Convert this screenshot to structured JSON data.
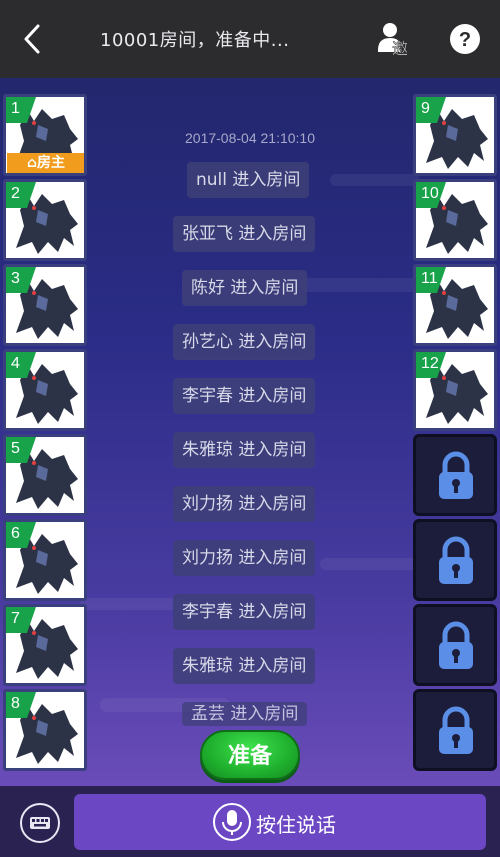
{
  "header": {
    "title": "10001房间，准备中...",
    "back_icon": "chevron-left-icon",
    "invite_icon": "invite-user-icon",
    "invite_label": "邀",
    "help_icon": "help-icon",
    "help_label": "?"
  },
  "chat": {
    "timestamp": "2017-08-04 21:10:10",
    "messages": [
      "null 进入房间",
      "张亚飞 进入房间",
      "陈好 进入房间",
      "孙艺心 进入房间",
      "李宇春 进入房间",
      "朱雅琼 进入房间",
      "刘力扬 进入房间",
      "刘力扬 进入房间",
      "李宇春 进入房间",
      "朱雅琼 进入房间",
      "孟芸 进入房间"
    ]
  },
  "seats_left": [
    {
      "num": "1",
      "host": "房主"
    },
    {
      "num": "2"
    },
    {
      "num": "3"
    },
    {
      "num": "4"
    },
    {
      "num": "5"
    },
    {
      "num": "6"
    },
    {
      "num": "7"
    },
    {
      "num": "8"
    }
  ],
  "seats_right": [
    {
      "num": "9"
    },
    {
      "num": "10"
    },
    {
      "num": "11"
    },
    {
      "num": "12"
    },
    {
      "locked": true
    },
    {
      "locked": true
    },
    {
      "locked": true
    },
    {
      "locked": true
    }
  ],
  "actions": {
    "ready_label": "准备",
    "talk_label": "按住说话",
    "keyboard_icon": "keyboard-icon",
    "mic_icon": "microphone-icon"
  },
  "colors": {
    "accent_green": "#18a34a",
    "host_orange": "#f19c1d",
    "talk_purple": "#6c47c4",
    "lock_blue": "#5b8ee6"
  }
}
